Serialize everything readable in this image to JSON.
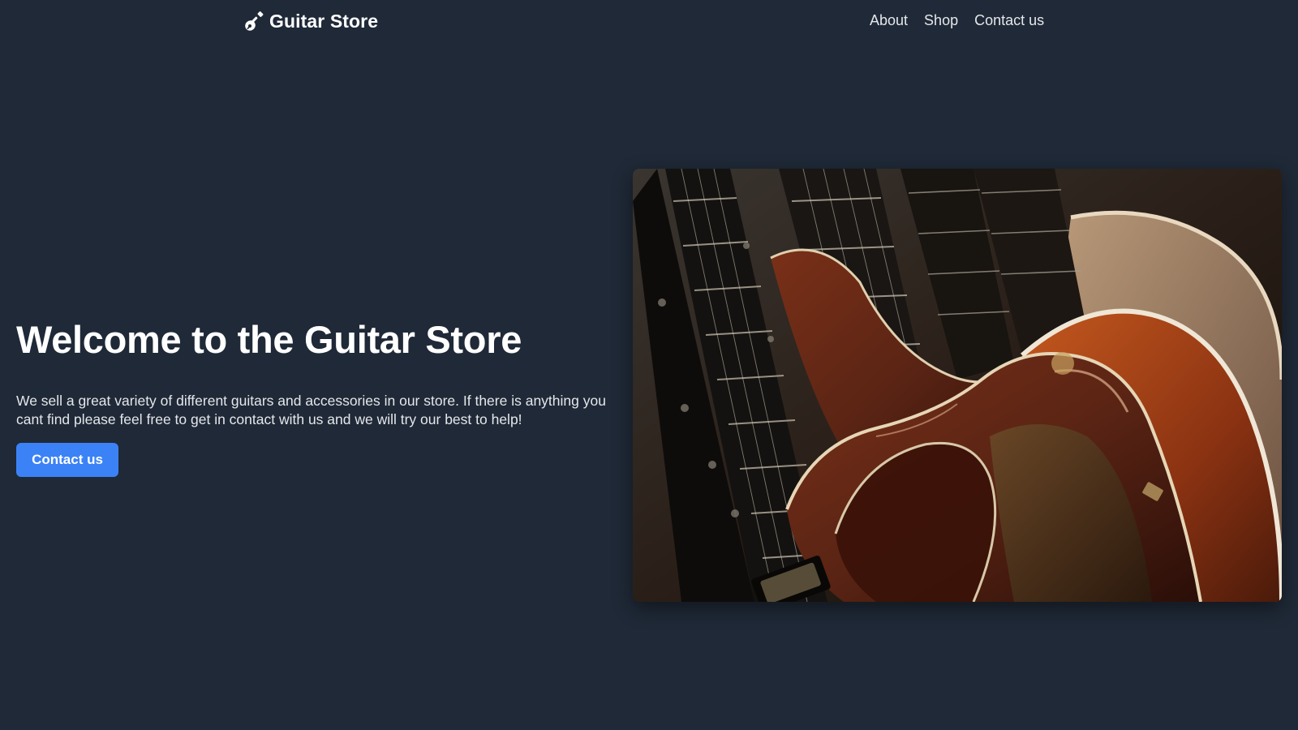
{
  "header": {
    "brand_name": "Guitar Store",
    "brand_icon": "guitar-icon",
    "nav": [
      {
        "label": "About"
      },
      {
        "label": "Shop"
      },
      {
        "label": "Contact us"
      }
    ]
  },
  "hero": {
    "title": "Welcome to the Guitar Store",
    "description": "We sell a great variety of different guitars and accessories in our store. If there is anything you cant find please feel free to get in contact with us and we will try our best to help!",
    "cta_label": "Contact us",
    "image_subject": "close-up photo of guitars lined up on a rack"
  },
  "colors": {
    "background": "#1f2937",
    "accent": "#3b82f6",
    "text": "#ffffff"
  }
}
